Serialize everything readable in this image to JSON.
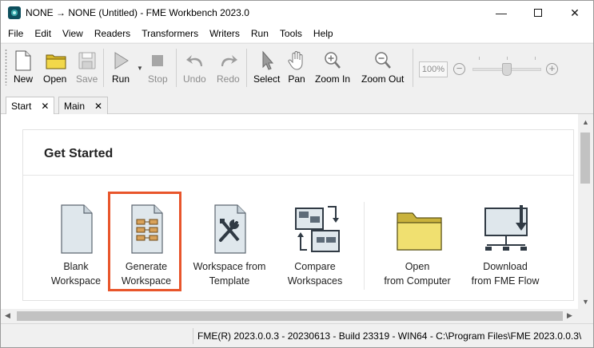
{
  "window": {
    "title": "NONE → NONE (Untitled) - FME Workbench 2023.0",
    "minimize_glyph": "—",
    "close_glyph": "✕"
  },
  "menu": [
    "File",
    "Edit",
    "View",
    "Readers",
    "Transformers",
    "Writers",
    "Run",
    "Tools",
    "Help"
  ],
  "toolbar": {
    "new": "New",
    "open": "Open",
    "save": "Save",
    "run": "Run",
    "stop": "Stop",
    "undo": "Undo",
    "redo": "Redo",
    "select": "Select",
    "pan": "Pan",
    "zoom_in": "Zoom In",
    "zoom_out": "Zoom Out",
    "zoom_level": "100%",
    "zoom_minus": "−",
    "zoom_plus": "+"
  },
  "tabs": [
    {
      "label": "Start",
      "active": true
    },
    {
      "label": "Main",
      "active": false
    }
  ],
  "tab_close_glyph": "✕",
  "start": {
    "title": "Get Started",
    "items": [
      {
        "line1": "Blank",
        "line2": "Workspace",
        "icon": "blank-document-icon"
      },
      {
        "line1": "Generate",
        "line2": "Workspace",
        "icon": "generate-workspace-icon"
      },
      {
        "line1": "Workspace from",
        "line2": "Template",
        "icon": "template-tools-icon"
      },
      {
        "line1": "Compare",
        "line2": "Workspaces",
        "icon": "compare-workspaces-icon"
      },
      {
        "line1": "Open",
        "line2": "from Computer",
        "icon": "folder-icon"
      },
      {
        "line1": "Download",
        "line2": "from FME Flow",
        "icon": "download-icon"
      }
    ]
  },
  "status": {
    "text": "FME(R) 2023.0.0.3 - 20230613 - Build 23319 - WIN64 - C:\\Program Files\\FME 2023.0.0.3\\"
  },
  "colors": {
    "highlight": "#e8552b",
    "folder": "#f0e070",
    "document": "#dfe7ec"
  }
}
